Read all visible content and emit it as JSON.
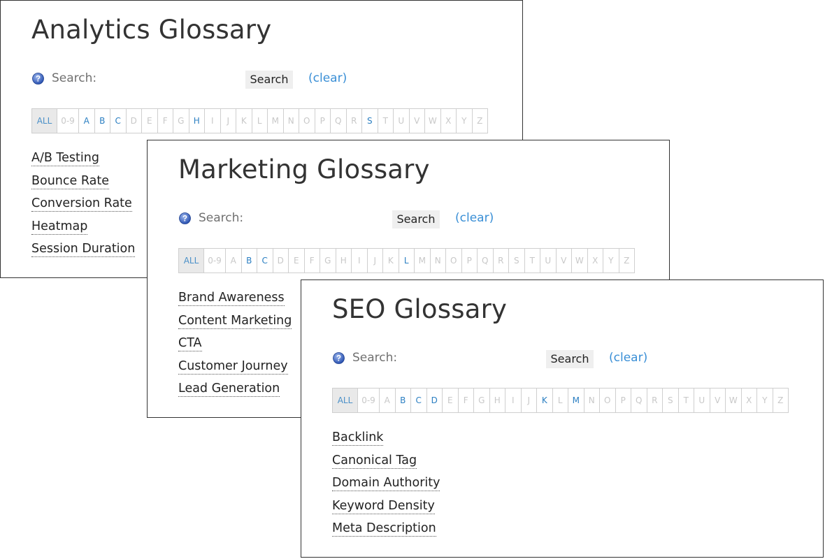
{
  "panels": [
    {
      "title": "Analytics Glossary",
      "search": {
        "label": "Search:",
        "placeholder": "",
        "value": "",
        "button_label": "Search",
        "clear_label": "(clear)"
      },
      "letters": [
        {
          "label": "ALL",
          "active": true
        },
        {
          "label": "0-9",
          "active": false
        },
        {
          "label": "A",
          "active": true
        },
        {
          "label": "B",
          "active": true
        },
        {
          "label": "C",
          "active": true
        },
        {
          "label": "D",
          "active": false
        },
        {
          "label": "E",
          "active": false
        },
        {
          "label": "F",
          "active": false
        },
        {
          "label": "G",
          "active": false
        },
        {
          "label": "H",
          "active": true
        },
        {
          "label": "I",
          "active": false
        },
        {
          "label": "J",
          "active": false
        },
        {
          "label": "K",
          "active": false
        },
        {
          "label": "L",
          "active": false
        },
        {
          "label": "M",
          "active": false
        },
        {
          "label": "N",
          "active": false
        },
        {
          "label": "O",
          "active": false
        },
        {
          "label": "P",
          "active": false
        },
        {
          "label": "Q",
          "active": false
        },
        {
          "label": "R",
          "active": false
        },
        {
          "label": "S",
          "active": true
        },
        {
          "label": "T",
          "active": false
        },
        {
          "label": "U",
          "active": false
        },
        {
          "label": "V",
          "active": false
        },
        {
          "label": "W",
          "active": false
        },
        {
          "label": "X",
          "active": false
        },
        {
          "label": "Y",
          "active": false
        },
        {
          "label": "Z",
          "active": false
        }
      ],
      "terms": [
        "A/B Testing",
        "Bounce Rate",
        "Conversion Rate",
        "Heatmap",
        "Session Duration"
      ]
    },
    {
      "title": "Marketing Glossary",
      "search": {
        "label": "Search:",
        "placeholder": "",
        "value": "",
        "button_label": "Search",
        "clear_label": "(clear)"
      },
      "letters": [
        {
          "label": "ALL",
          "active": true
        },
        {
          "label": "0-9",
          "active": false
        },
        {
          "label": "A",
          "active": false
        },
        {
          "label": "B",
          "active": true
        },
        {
          "label": "C",
          "active": true
        },
        {
          "label": "D",
          "active": false
        },
        {
          "label": "E",
          "active": false
        },
        {
          "label": "F",
          "active": false
        },
        {
          "label": "G",
          "active": false
        },
        {
          "label": "H",
          "active": false
        },
        {
          "label": "I",
          "active": false
        },
        {
          "label": "J",
          "active": false
        },
        {
          "label": "K",
          "active": false
        },
        {
          "label": "L",
          "active": true
        },
        {
          "label": "M",
          "active": false
        },
        {
          "label": "N",
          "active": false
        },
        {
          "label": "O",
          "active": false
        },
        {
          "label": "P",
          "active": false
        },
        {
          "label": "Q",
          "active": false
        },
        {
          "label": "R",
          "active": false
        },
        {
          "label": "S",
          "active": false
        },
        {
          "label": "T",
          "active": false
        },
        {
          "label": "U",
          "active": false
        },
        {
          "label": "V",
          "active": false
        },
        {
          "label": "W",
          "active": false
        },
        {
          "label": "X",
          "active": false
        },
        {
          "label": "Y",
          "active": false
        },
        {
          "label": "Z",
          "active": false
        }
      ],
      "terms": [
        "Brand Awareness",
        "Content Marketing",
        "CTA",
        "Customer Journey",
        "Lead Generation"
      ]
    },
    {
      "title": "SEO Glossary",
      "search": {
        "label": "Search:",
        "placeholder": "",
        "value": "",
        "button_label": "Search",
        "clear_label": "(clear)"
      },
      "letters": [
        {
          "label": "ALL",
          "active": true
        },
        {
          "label": "0-9",
          "active": false
        },
        {
          "label": "A",
          "active": false
        },
        {
          "label": "B",
          "active": true
        },
        {
          "label": "C",
          "active": true
        },
        {
          "label": "D",
          "active": true
        },
        {
          "label": "E",
          "active": false
        },
        {
          "label": "F",
          "active": false
        },
        {
          "label": "G",
          "active": false
        },
        {
          "label": "H",
          "active": false
        },
        {
          "label": "I",
          "active": false
        },
        {
          "label": "J",
          "active": false
        },
        {
          "label": "K",
          "active": true
        },
        {
          "label": "L",
          "active": false
        },
        {
          "label": "M",
          "active": true
        },
        {
          "label": "N",
          "active": false
        },
        {
          "label": "O",
          "active": false
        },
        {
          "label": "P",
          "active": false
        },
        {
          "label": "Q",
          "active": false
        },
        {
          "label": "R",
          "active": false
        },
        {
          "label": "S",
          "active": false
        },
        {
          "label": "T",
          "active": false
        },
        {
          "label": "U",
          "active": false
        },
        {
          "label": "V",
          "active": false
        },
        {
          "label": "W",
          "active": false
        },
        {
          "label": "X",
          "active": false
        },
        {
          "label": "Y",
          "active": false
        },
        {
          "label": "Z",
          "active": false
        }
      ],
      "terms": [
        "Backlink",
        "Canonical Tag",
        "Domain Authority",
        "Keyword Density",
        "Meta Description"
      ]
    }
  ],
  "icons": {
    "help": "help-question-icon"
  },
  "colors": {
    "link": "#3a8fd6",
    "active_letter": "#2b7fc2",
    "inactive_letter": "#c8c8c8",
    "title": "#333333",
    "border": "#333333"
  }
}
